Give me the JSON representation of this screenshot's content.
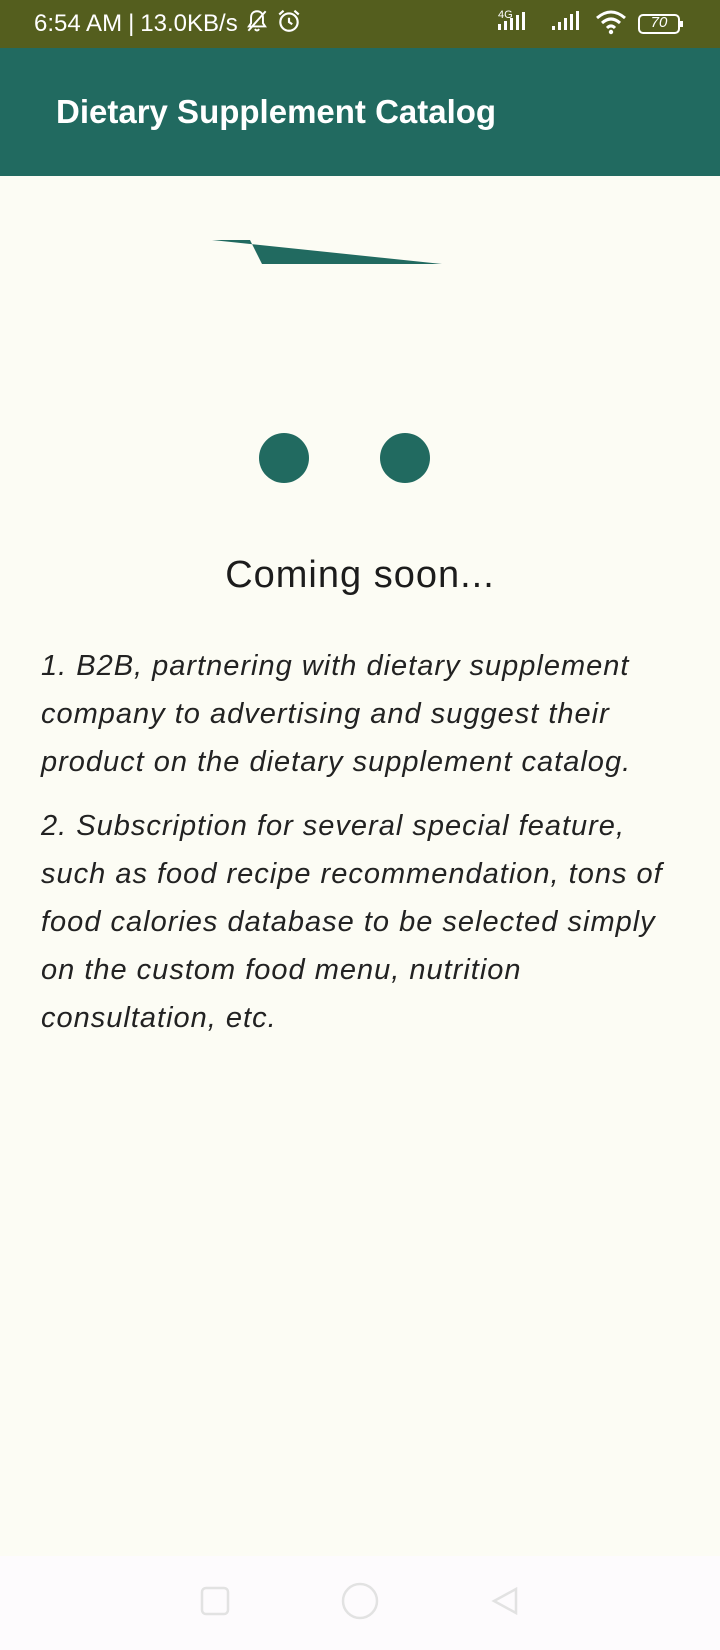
{
  "status_bar": {
    "time": "6:54 AM",
    "separator": "|",
    "speed": "13.0KB/s",
    "network_label": "4G",
    "battery": "70",
    "icons": [
      "bell-off-icon",
      "alarm-icon",
      "signal-4g-icon",
      "signal-icon",
      "wifi-icon",
      "battery-icon"
    ]
  },
  "app_bar": {
    "title": "Dietary Supplement Catalog"
  },
  "main": {
    "icon": "shopping-cart-icon",
    "coming_soon": "Coming soon...",
    "items": [
      "1. B2B, partnering with dietary supplement company to advertising and suggest their product on the dietary supplement catalog.",
      "2. Subscription for several special feature, such as food recipe recommendation, tons of food calories database to be selected simply on the custom food menu, nutrition consultation, etc."
    ]
  },
  "colors": {
    "status_bar": "#545e1e",
    "app_bar": "#216a60",
    "accent": "#216a60",
    "background": "#fcfcf4"
  },
  "nav_bar": {
    "buttons": [
      "recent-apps-button",
      "home-button",
      "back-button"
    ]
  }
}
